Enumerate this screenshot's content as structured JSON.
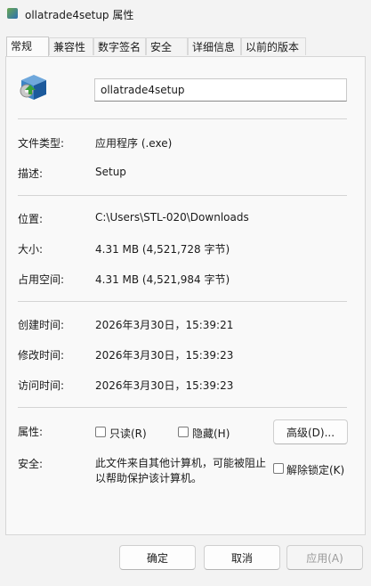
{
  "window": {
    "title": "ollatrade4setup 属性"
  },
  "tabs": [
    "常规",
    "兼容性",
    "数字签名",
    "安全",
    "详细信息",
    "以前的版本"
  ],
  "general": {
    "file_name": "ollatrade4setup",
    "file_type_label": "文件类型:",
    "file_type_value": "应用程序 (.exe)",
    "description_label": "描述:",
    "description_value": "Setup",
    "location_label": "位置:",
    "location_value": "C:\\Users\\STL-020\\Downloads",
    "size_label": "大小:",
    "size_value": "4.31 MB (4,521,728 字节)",
    "size_on_disk_label": "占用空间:",
    "size_on_disk_value": "4.31 MB (4,521,984 字节)",
    "created_label": "创建时间:",
    "created_value": "2026年3月30日，15:39:21",
    "modified_label": "修改时间:",
    "modified_value": "2026年3月30日，15:39:23",
    "accessed_label": "访问时间:",
    "accessed_value": "2026年3月30日，15:39:23",
    "attributes_label": "属性:",
    "readonly_label": "只读(R)",
    "hidden_label": "隐藏(H)",
    "advanced_button": "高级(D)...",
    "security_label": "安全:",
    "security_text": "此文件来自其他计算机，可能被阻止以帮助保护该计算机。",
    "unblock_label": "解除锁定(K)"
  },
  "footer": {
    "ok": "确定",
    "cancel": "取消",
    "apply": "应用(A)"
  }
}
